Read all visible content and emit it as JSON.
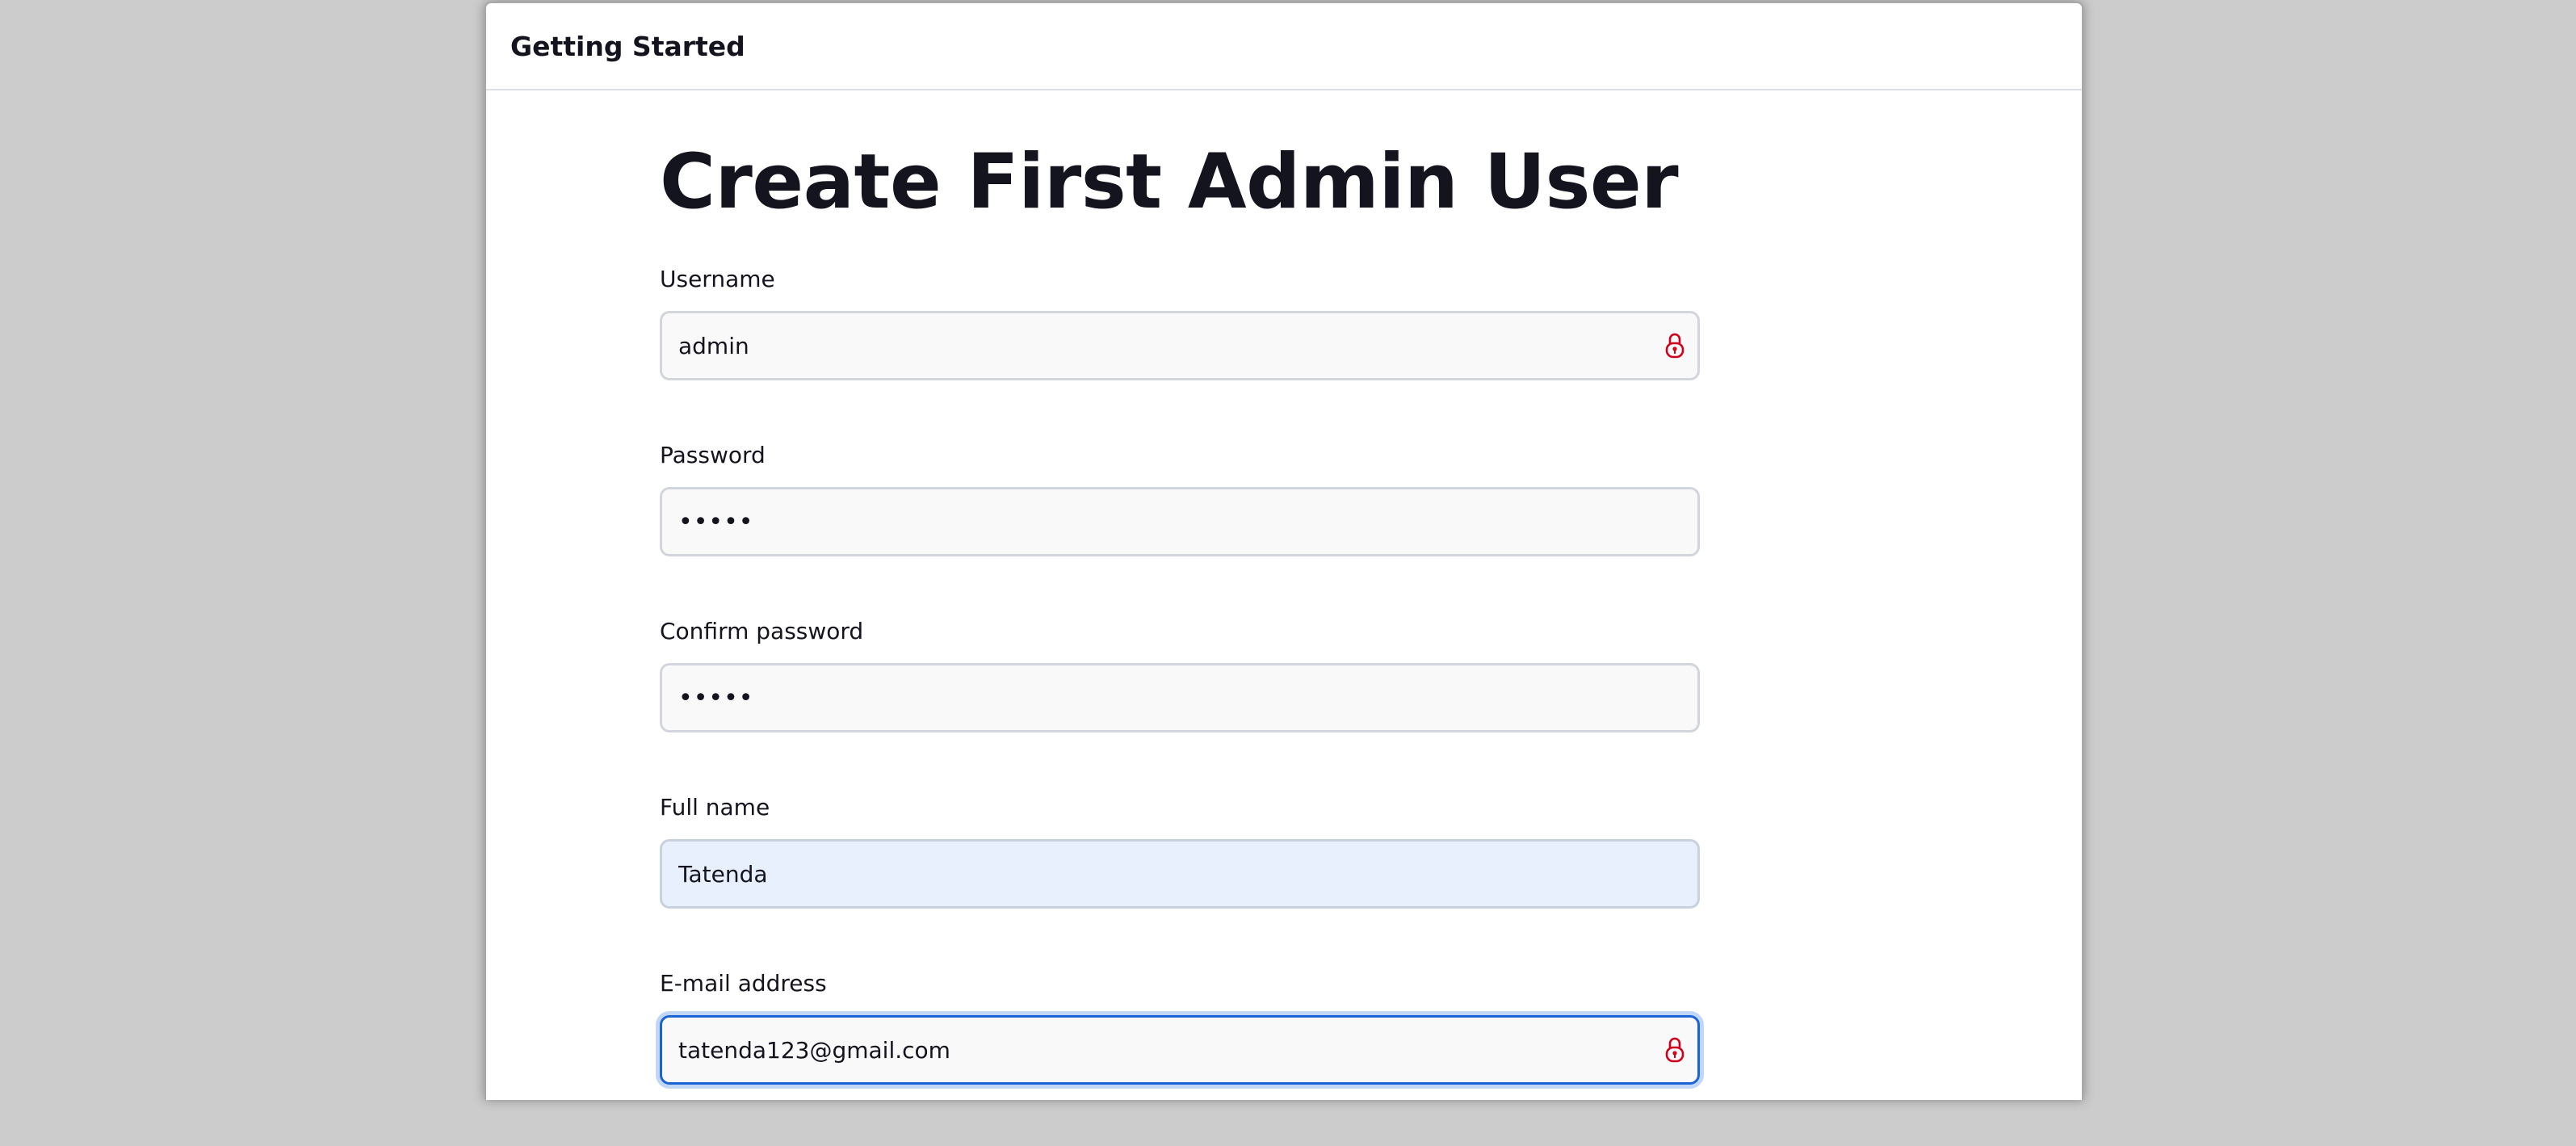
{
  "dialog": {
    "title": "Getting Started"
  },
  "form": {
    "heading": "Create First Admin User",
    "fields": {
      "username": {
        "label": "Username",
        "value": "admin"
      },
      "password": {
        "label": "Password",
        "value": "•••••"
      },
      "confirm_password": {
        "label": "Confirm password",
        "value": "•••••"
      },
      "full_name": {
        "label": "Full name",
        "value": "Tatenda"
      },
      "email": {
        "label": "E-mail address",
        "value": "tatenda123@gmail.com"
      }
    }
  },
  "icons": {
    "password_manager": "lock-icon"
  },
  "colors": {
    "background": "#cccccc",
    "focus_border": "#1c63d6",
    "autofill_bg": "#e8f0fe",
    "icon_red": "#d0021b"
  }
}
